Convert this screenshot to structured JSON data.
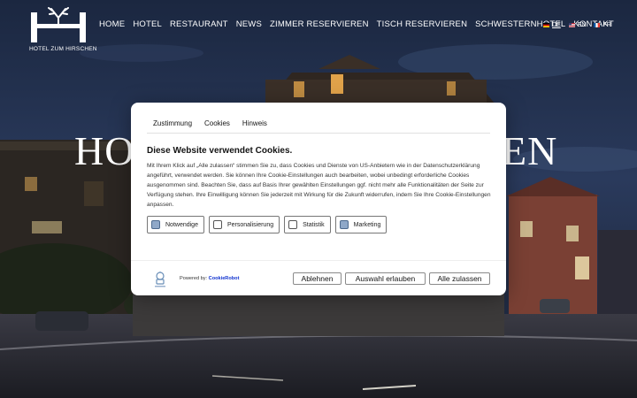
{
  "site": {
    "logo_text": "HOTEL ZUM HIRSCHEN",
    "hero_title_start": "HO",
    "hero_title_end": "EN"
  },
  "nav": {
    "items": [
      "HOME",
      "HOTEL",
      "RESTAURANT",
      "NEWS",
      "ZIMMER RESERVIEREN",
      "TISCH RESERVIEREN",
      "SCHWESTERNHOTEL",
      "KONTAKT"
    ]
  },
  "languages": [
    {
      "label": "DE",
      "active": true
    },
    {
      "label": "EN",
      "active": false
    },
    {
      "label": "FR",
      "active": false
    }
  ],
  "dialog": {
    "tabs": [
      "Zustimmung",
      "Cookies",
      "Hinweis"
    ],
    "title": "Diese Website verwendet Cookies.",
    "body": "Mit Ihrem Klick auf „Alle zulassen“ stimmen Sie zu, dass Cookies und Dienste von US-Anbietern wie in der Datenschutzerklärung angeführt, verwendet werden. Sie können Ihre Cookie-Einstellungen auch bearbeiten, wobei unbedingt erforderliche Cookies ausgenommen sind. Beachten Sie, dass auf Basis Ihrer gewählten Einstellungen ggf. nicht mehr alle Funktionalitäten der Seite zur Verfügung stehen. Ihre Einwilligung können Sie jederzeit mit Wirkung für die Zukunft widerrufen, indem Sie Ihre Cookie-Einstellungen anpassen.",
    "checkboxes": [
      {
        "label": "Notwendige",
        "checked": true
      },
      {
        "label": "Personalisierung",
        "checked": false
      },
      {
        "label": "Statistik",
        "checked": false
      },
      {
        "label": "Marketing",
        "checked": true
      }
    ],
    "powered_prefix": "Powered by: ",
    "powered_brand": "CookieRobot",
    "buttons": {
      "decline": "Ablehnen",
      "allow_selection": "Auswahl erlauben",
      "allow_all": "Alle zulassen"
    }
  },
  "colors": {
    "checkbox_checked": "#8fa8c8",
    "brand_link": "#1032cf"
  }
}
